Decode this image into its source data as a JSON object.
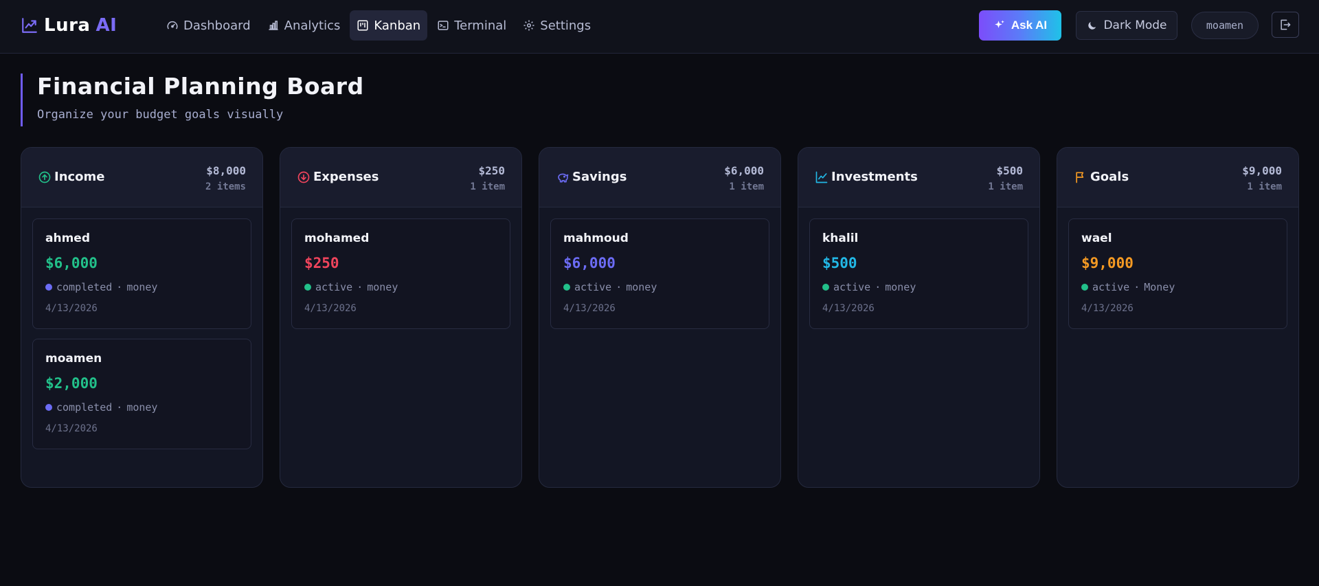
{
  "app": {
    "brand": "Lura",
    "brand_accent": "AI",
    "accent_color": "#7b6cf6"
  },
  "nav": {
    "items": [
      {
        "label": "Dashboard",
        "icon": "gauge-icon",
        "active": false
      },
      {
        "label": "Analytics",
        "icon": "bar-chart-icon",
        "active": false
      },
      {
        "label": "Kanban",
        "icon": "kanban-icon",
        "active": true
      },
      {
        "label": "Terminal",
        "icon": "terminal-icon",
        "active": false
      },
      {
        "label": "Settings",
        "icon": "gear-icon",
        "active": false
      }
    ]
  },
  "header": {
    "ask_ai_label": "Ask AI",
    "dark_mode_label": "Dark Mode",
    "username": "moamen",
    "logout_icon": "logout-icon"
  },
  "page": {
    "title": "Financial Planning Board",
    "subtitle": "Organize your budget goals visually"
  },
  "columns": [
    {
      "title": "Income",
      "icon": "arrow-up-circle-icon",
      "icon_color": "#22c08a",
      "total": "$8,000",
      "count": "2 items",
      "cards": [
        {
          "name": "ahmed",
          "amount": "$6,000",
          "amount_color": "#22c08a",
          "status": "completed",
          "dot_color": "#6c6cf5",
          "category": "money",
          "date": "4/13/2026"
        },
        {
          "name": "moamen",
          "amount": "$2,000",
          "amount_color": "#22c08a",
          "status": "completed",
          "dot_color": "#6c6cf5",
          "category": "money",
          "date": "4/13/2026"
        }
      ]
    },
    {
      "title": "Expenses",
      "icon": "arrow-down-circle-icon",
      "icon_color": "#f0445c",
      "total": "$250",
      "count": "1 item",
      "cards": [
        {
          "name": "mohamed",
          "amount": "$250",
          "amount_color": "#f0445c",
          "status": "active",
          "dot_color": "#22c08a",
          "category": "money",
          "date": "4/13/2026"
        }
      ]
    },
    {
      "title": "Savings",
      "icon": "piggy-bank-icon",
      "icon_color": "#6c6cf5",
      "total": "$6,000",
      "count": "1 item",
      "cards": [
        {
          "name": "mahmoud",
          "amount": "$6,000",
          "amount_color": "#6c6cf5",
          "status": "active",
          "dot_color": "#22c08a",
          "category": "money",
          "date": "4/13/2026"
        }
      ]
    },
    {
      "title": "Investments",
      "icon": "trending-up-icon",
      "icon_color": "#22b8e6",
      "total": "$500",
      "count": "1 item",
      "cards": [
        {
          "name": "khalil",
          "amount": "$500",
          "amount_color": "#22b8e6",
          "status": "active",
          "dot_color": "#22c08a",
          "category": "money",
          "date": "4/13/2026"
        }
      ]
    },
    {
      "title": "Goals",
      "icon": "flag-icon",
      "icon_color": "#f59a23",
      "total": "$9,000",
      "count": "1 item",
      "cards": [
        {
          "name": "wael",
          "amount": "$9,000",
          "amount_color": "#f59a23",
          "status": "active",
          "dot_color": "#22c08a",
          "category": "Money",
          "date": "4/13/2026"
        }
      ]
    }
  ]
}
